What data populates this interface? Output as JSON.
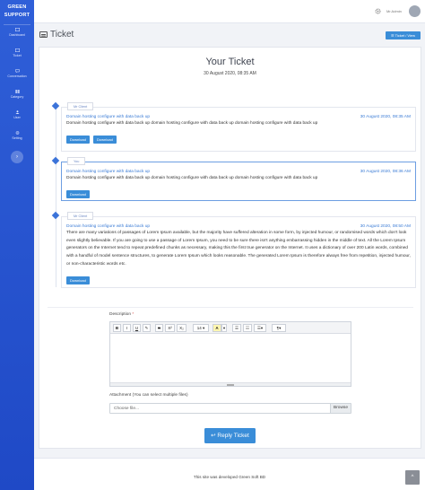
{
  "brand": {
    "line1": "GREEN",
    "line2": "SUPPORT"
  },
  "sidebar": {
    "items": [
      {
        "label": "Dashboard",
        "icon": "dashboard-icon"
      },
      {
        "label": "Ticket",
        "icon": "ticket-icon"
      },
      {
        "label": "Conversation",
        "icon": "conversation-icon"
      },
      {
        "label": "Category",
        "icon": "category-icon"
      },
      {
        "label": "User",
        "icon": "user-icon"
      },
      {
        "label": "Setting",
        "icon": "setting-icon"
      }
    ],
    "toggle_glyph": "›"
  },
  "topbar": {
    "user_name": "Mr.Admin"
  },
  "page": {
    "title": "Ticket",
    "view_button": "Ticket / View"
  },
  "ticket": {
    "title": "Your Ticket",
    "date": "30 August 2020, 08:35 AM",
    "messages": [
      {
        "author": "Mr Client",
        "subject": "Domain hosting configure with data back up",
        "date": "30 August 2020, 08:35 AM",
        "body": "Domain hosting configure with data back up domain hosting configure with data back up domain hosting configure with data back up",
        "buttons": [
          "Download",
          "Download"
        ]
      },
      {
        "author": "You",
        "subject": "Domain hosting configure with data back up",
        "date": "30 August 2020, 08:36 AM",
        "body": "Domain hosting configure with data back up domain hosting configure with data back up domain hosting configure with data back up",
        "buttons": [
          "Download"
        ]
      },
      {
        "author": "Mr Client",
        "subject": "Domain hosting configure with data back up",
        "date": "30 August 2020, 08:50 AM",
        "body": "There are many variations of passages of Lorem Ipsum available, but the majority have suffered alteration in some form, by injected humour, or randomised words which don't look even slightly believable. If you are going to use a passage of Lorem Ipsum, you need to be sure there isn't anything embarrassing hidden in the middle of text. All the Lorem Ipsum generators on the Internet tend to repeat predefined chunks as necessary, making this the first true generator on the Internet. It uses a dictionary of over 200 Latin words, combined with a handful of model sentence structures, to generate Lorem Ipsum which looks reasonable. The generated Lorem Ipsum is therefore always free from repetition, injected humour, or non-characteristic words etc.",
        "buttons": [
          "Download"
        ]
      }
    ]
  },
  "form": {
    "description_label": "Description",
    "required_mark": "*",
    "toolbar": {
      "bold": "B",
      "italic": "I",
      "underline": "U",
      "eraser": "✎",
      "strike": "S",
      "superscript": "X²",
      "subscript": "X₂",
      "font_size": "14 ▾",
      "color": "A",
      "color_caret": "▾",
      "ul": "☰",
      "ol": "☷",
      "align": "☰▾",
      "para": "¶▾"
    },
    "attachment_label": "Attachment (You can select multiple files)",
    "file_placeholder": "Choose file...",
    "browse_label": "Browse",
    "reply_label": "↩ Reply Ticket"
  },
  "footer": {
    "text": "This site was developed Green Soft BD",
    "scroll_top_glyph": "^"
  },
  "colors": {
    "sidebar": "#2f5fd8",
    "accent": "#3a8dd8",
    "link": "#3a7bd5"
  }
}
